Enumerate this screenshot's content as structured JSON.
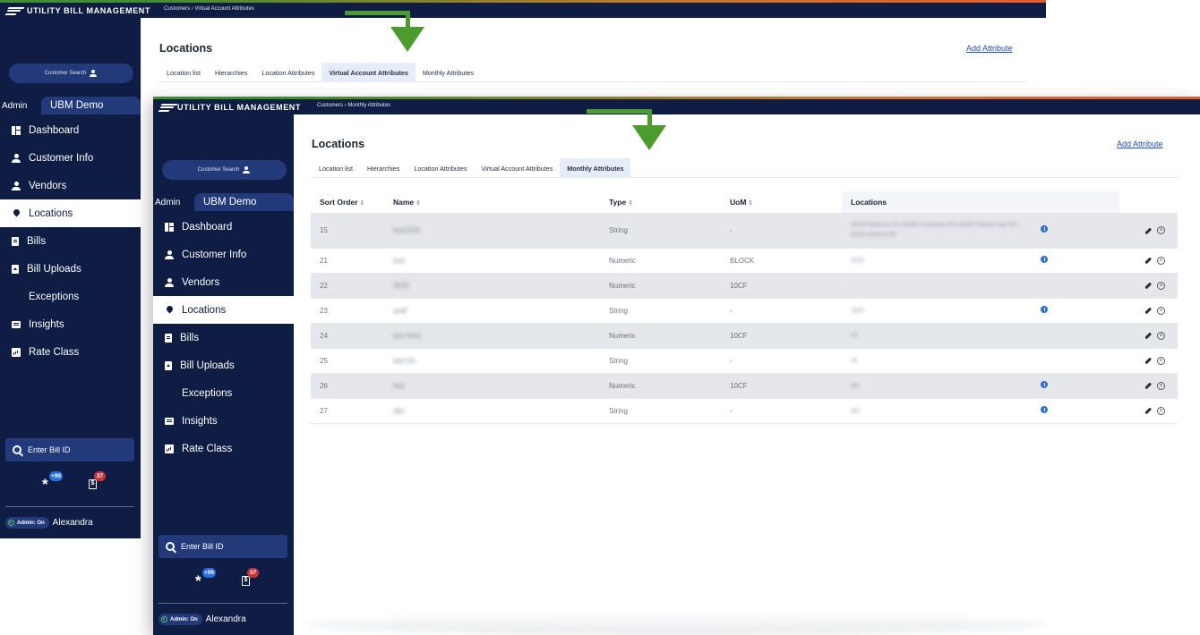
{
  "app": {
    "brand": "UTILITY BILL MANAGEMENT"
  },
  "colors": {
    "navy": "#0f1d45",
    "accent_green": "#4c9b2e",
    "active_tab": "#e6edf8",
    "link": "#1f4fa8",
    "info_blue": "#2f6fdc"
  },
  "sidebar": {
    "customer_search": "Customer Search",
    "admin_label": "Admin",
    "org_name": "UBM Demo",
    "items": [
      {
        "label": "Dashboard",
        "icon": "dashboard-icon"
      },
      {
        "label": "Customer Info",
        "icon": "person-icon"
      },
      {
        "label": "Vendors",
        "icon": "person-icon"
      },
      {
        "label": "Locations",
        "icon": "location-pin-icon"
      },
      {
        "label": "Bills",
        "icon": "document-icon"
      },
      {
        "label": "Bill Uploads",
        "icon": "upload-icon"
      },
      {
        "label": "Exceptions",
        "icon": "exclamation-icon"
      },
      {
        "label": "Insights",
        "icon": "insights-icon"
      },
      {
        "label": "Rate Class",
        "icon": "chart-icon"
      }
    ],
    "bill_search_placeholder": "Enter Bill ID",
    "notif_badge": "+99",
    "bills_badge": "37",
    "admin_status": "Admin: On",
    "user_name": "Alexandra"
  },
  "back_window": {
    "breadcrumb": "Customers › Virtual Account Attributes",
    "title": "Locations",
    "add_attribute": "Add Attribute",
    "tabs": [
      "Location list",
      "Hierarchies",
      "Location Attributes",
      "Virtual Account Attributes",
      "Monthly Attributes"
    ],
    "active_tab": 3
  },
  "front_window": {
    "breadcrumb": "Customers › Monthly Attributes",
    "title": "Locations",
    "add_attribute": "Add Attribute",
    "tabs": [
      "Location list",
      "Hierarchies",
      "Location Attributes",
      "Virtual Account Attributes",
      "Monthly Attributes"
    ],
    "active_tab": 4,
    "table": {
      "headers": [
        "Sort Order",
        "Name",
        "Type",
        "UoM",
        "Locations"
      ],
      "rows": [
        {
          "sort": "15",
          "name": "test2345",
          "type": "String",
          "uom": "-",
          "locations": "00000 Madison St | 00000 Cranberry PA | 0000 S Mount Joy PA | 0000 Ardmore PA",
          "info": true
        },
        {
          "sort": "21",
          "name": "test",
          "type": "Numeric",
          "uom": "BLOCK",
          "locations": "1629",
          "info": true
        },
        {
          "sort": "22",
          "name": "4520",
          "type": "Numeric",
          "uom": "10CF",
          "locations": "-",
          "info": false
        },
        {
          "sort": "23",
          "name": "asdf",
          "type": "String",
          "uom": "-",
          "locations": "1629",
          "info": true
        },
        {
          "sort": "24",
          "name": "test Mea",
          "type": "Numeric",
          "uom": "10CF",
          "locations": "All",
          "info": false
        },
        {
          "sort": "25",
          "name": "test Att",
          "type": "String",
          "uom": "-",
          "locations": "All",
          "info": false
        },
        {
          "sort": "26",
          "name": "test",
          "type": "Numeric",
          "uom": "10CF",
          "locations": "abc",
          "info": true
        },
        {
          "sort": "27",
          "name": "abc",
          "type": "String",
          "uom": "-",
          "locations": "abc",
          "info": true
        }
      ]
    }
  }
}
